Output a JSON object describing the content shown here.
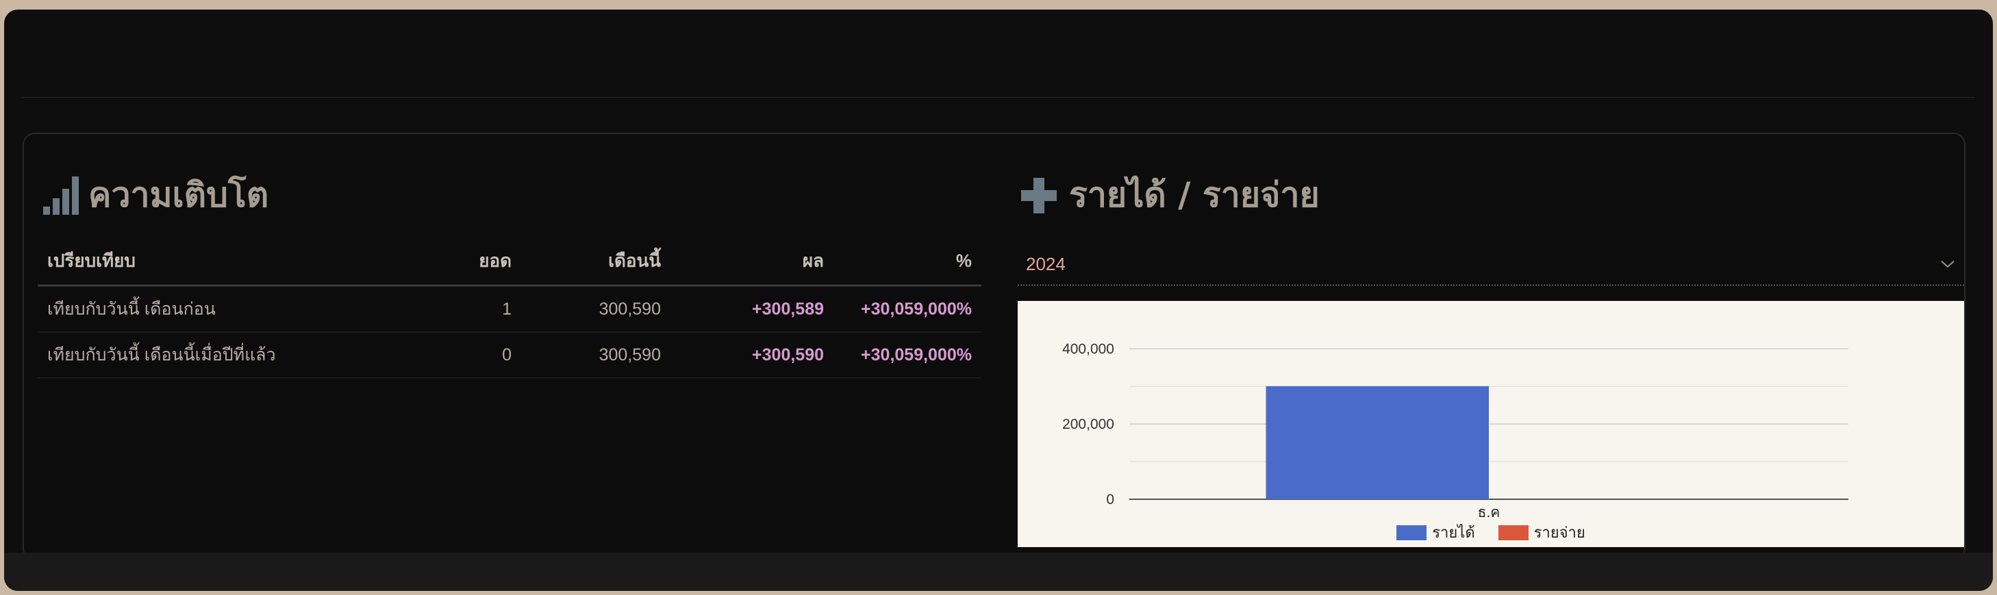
{
  "colors": {
    "background": "#cbb8a3",
    "frame": "#0e0e0e",
    "title": "#a59d92",
    "positive_value": "#d79ad0",
    "year_text": "#e6a49a",
    "income_series": "#4a6cc8",
    "expense_series": "#d9573b"
  },
  "growth": {
    "title": "ความเติบโต",
    "icon": "bar-chart-icon",
    "columns": [
      "เปรียบเทียบ",
      "ยอด",
      "เดือนนี้",
      "ผล",
      "%"
    ],
    "rows": [
      {
        "compare": "เทียบกับวันนี้ เดือนก่อน",
        "amount": "1",
        "this_month": "300,590",
        "result": "+300,589",
        "percent": "+30,059,000%"
      },
      {
        "compare": "เทียบกับวันนี้ เดือนนี้เมื่อปีที่แล้ว",
        "amount": "0",
        "this_month": "300,590",
        "result": "+300,590",
        "percent": "+30,059,000%"
      }
    ]
  },
  "income_expense": {
    "title": "รายได้ / รายจ่าย",
    "icon": "plus-icon",
    "year_select": {
      "value": "2024",
      "icon": "chevron-down-icon"
    }
  },
  "chart_data": {
    "type": "bar",
    "categories": [
      "ธ.ค"
    ],
    "series": [
      {
        "name": "รายได้",
        "values": [
          300590
        ],
        "color": "#4a6cc8"
      },
      {
        "name": "รายจ่าย",
        "values": [
          0
        ],
        "color": "#d9573b"
      }
    ],
    "yticks": [
      "0",
      "200,000",
      "400,000"
    ],
    "ylim": [
      0,
      400000
    ],
    "grid": true,
    "legend_position": "bottom"
  }
}
